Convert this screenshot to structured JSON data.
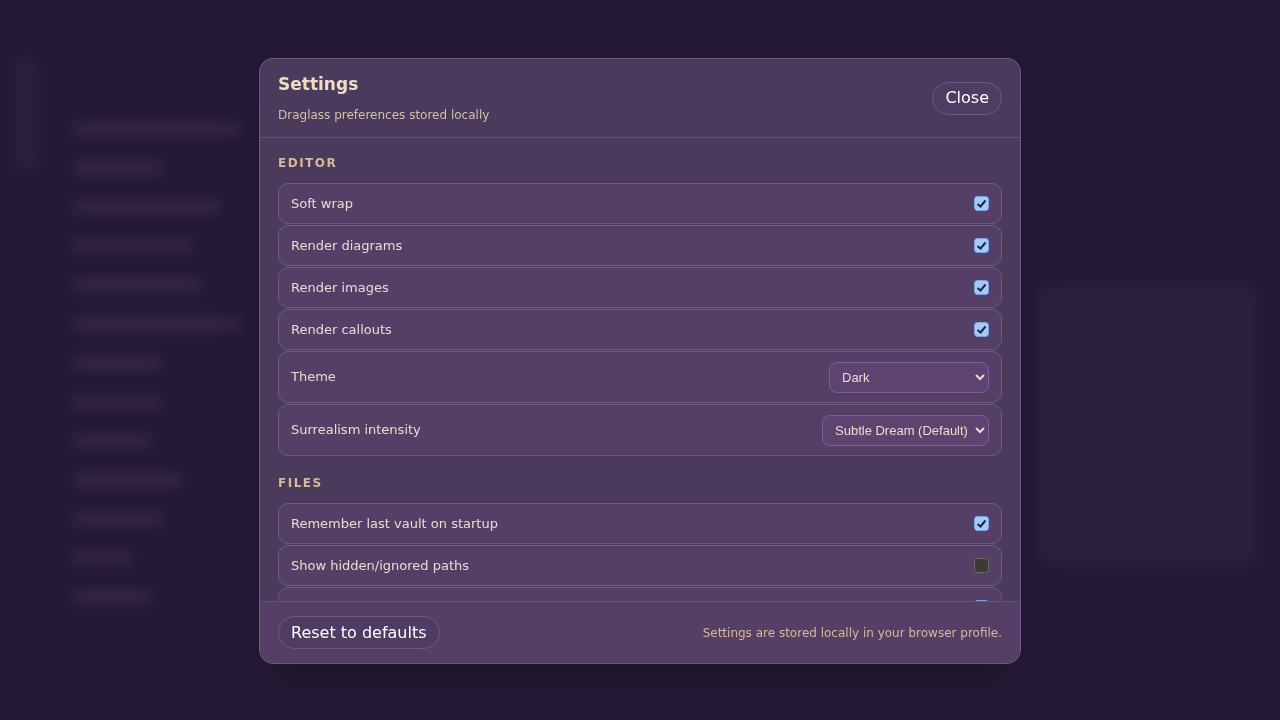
{
  "dialog": {
    "title": "Settings",
    "subtitle": "Draglass preferences stored locally",
    "close_button": "Close"
  },
  "sections": [
    {
      "heading": "EDITOR",
      "rows": [
        {
          "kind": "checkbox",
          "label": "Soft wrap",
          "checked": true
        },
        {
          "kind": "checkbox",
          "label": "Render diagrams",
          "checked": true
        },
        {
          "kind": "checkbox",
          "label": "Render images",
          "checked": true
        },
        {
          "kind": "checkbox",
          "label": "Render callouts",
          "checked": true
        },
        {
          "kind": "select",
          "label": "Theme",
          "value": "Dark"
        },
        {
          "kind": "select",
          "label": "Surrealism intensity",
          "value": "Subtle Dream (Default)"
        }
      ]
    },
    {
      "heading": "FILES",
      "rows": [
        {
          "kind": "checkbox",
          "label": "Remember last vault on startup",
          "checked": true
        },
        {
          "kind": "checkbox",
          "label": "Show hidden/ignored paths",
          "checked": false
        },
        {
          "kind": "checkbox",
          "checked": true
        }
      ]
    }
  ],
  "footer": {
    "reset_button": "Reset to defaults",
    "note": "Settings are stored locally in your browser profile."
  }
}
